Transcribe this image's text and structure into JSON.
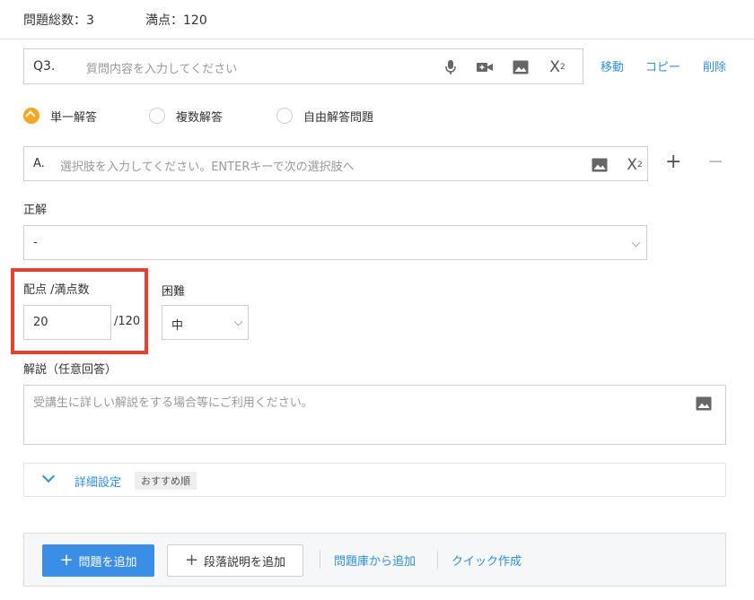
{
  "summary": {
    "total_label": "問題総数：3",
    "full_score_label": "満点：120"
  },
  "question": {
    "number": "Q3.",
    "placeholder": "質問内容を入力してください",
    "toolbar_icons": [
      "microphone-icon",
      "video-camera-icon",
      "image-icon",
      "superscript-icon"
    ],
    "superscript_label": "X",
    "superscript_sup": "2"
  },
  "actions": {
    "move": "移動",
    "copy": "コピー",
    "delete": "削除"
  },
  "answer_types": {
    "selected": "単一解答",
    "options": [
      "単一解答",
      "複数解答",
      "自由解答問題"
    ]
  },
  "choice": {
    "letter": "A.",
    "placeholder": "選択肢を入力してください。ENTERキーで次の選択肢へ",
    "add": "+",
    "remove": "−"
  },
  "correct_answer": {
    "label": "正解",
    "value": "-"
  },
  "score": {
    "label": "配点 /満点数",
    "value": "20",
    "max": "/120"
  },
  "difficulty": {
    "label": "困難",
    "value": "中"
  },
  "explanation": {
    "label": "解説（任意回答）",
    "placeholder": "受講生に詳しい解説をする場合等にご利用ください。"
  },
  "details": {
    "link": "詳細設定",
    "badge": "おすすめ順"
  },
  "bottom": {
    "add_question": "問題を追加",
    "add_paragraph": "段落説明を追加",
    "from_bank": "問題庫から追加",
    "quick_create": "クイック作成"
  },
  "colors": {
    "accent": "#2f8fdf",
    "primary_button": "#3a8ee6",
    "radio_selected": "#f5a623",
    "highlight_border": "#e8402c"
  }
}
